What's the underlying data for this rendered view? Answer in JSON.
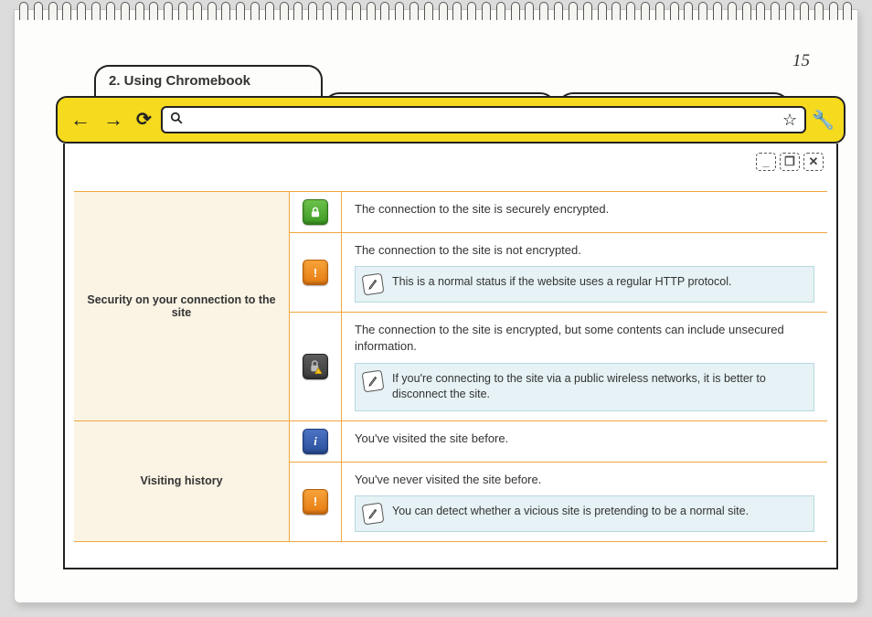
{
  "page_number": "15",
  "tab_title": "2. Using Chromebook",
  "window_controls": {
    "minimize": "_",
    "maximize": "❐",
    "close": "✕"
  },
  "sections": [
    {
      "label": "Security on your connection to the site",
      "rows": [
        {
          "icon": "lock-green",
          "text": "The connection to the site is securely encrypted."
        },
        {
          "icon": "warn-orange",
          "text": "The connection to the site is not encrypted.",
          "note": "This is a normal status if the website uses a regular HTTP protocol."
        },
        {
          "icon": "lock-warn-dark",
          "text": "The connection to the site is encrypted, but some contents can include unsecured information.",
          "note": "If you're connecting to the site via a public wireless networks, it is better to disconnect the site."
        }
      ]
    },
    {
      "label": "Visiting history",
      "rows": [
        {
          "icon": "info-blue",
          "text": "You've visited the site before."
        },
        {
          "icon": "warn-orange",
          "text": "You've never visited the site before.",
          "note": "You can detect whether a vicious site is pretending to be a normal site."
        }
      ]
    }
  ]
}
